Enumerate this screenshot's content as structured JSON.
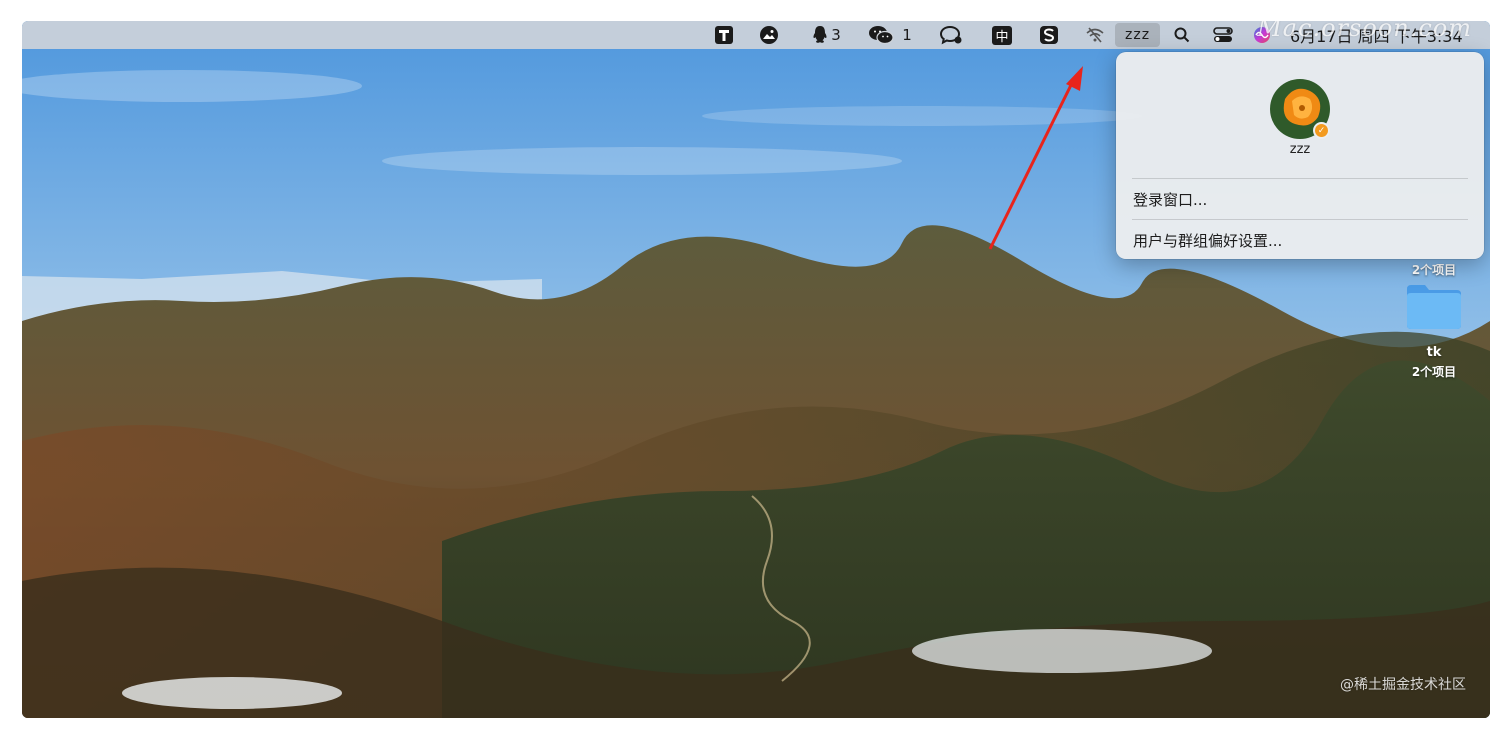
{
  "menubar": {
    "tray_icons": [
      {
        "name": "typora-icon",
        "badge": ""
      },
      {
        "name": "photo-app-icon",
        "badge": ""
      },
      {
        "name": "qq-icon",
        "badge": "3"
      },
      {
        "name": "wechat-icon",
        "badge": "1"
      },
      {
        "name": "chat-bubble-icon",
        "badge": ""
      },
      {
        "name": "input-method-icon",
        "label": "中"
      },
      {
        "name": "s-app-icon",
        "badge": ""
      },
      {
        "name": "wifi-off-icon",
        "badge": ""
      }
    ],
    "qq_badge": "3",
    "wechat_badge": "1",
    "input_method_label": "中",
    "user_name": "zzz",
    "clock": "6月17日 周四 下午3:34",
    "watermark": "Mac.orsoon.com"
  },
  "user_menu": {
    "user_name": "zzz",
    "items": [
      "登录窗口...",
      "用户与群组偏好设置..."
    ]
  },
  "desktop": {
    "items": [
      {
        "name": "",
        "count": "2个项目"
      },
      {
        "name": "tk",
        "count": "2个项目"
      }
    ]
  },
  "footer_watermark": "@稀土掘金技术社区",
  "colors": {
    "menubar": "#ced3d9",
    "arrow": "#e8241c",
    "folder": "#5aaef0",
    "badge": "#f39a1e"
  }
}
